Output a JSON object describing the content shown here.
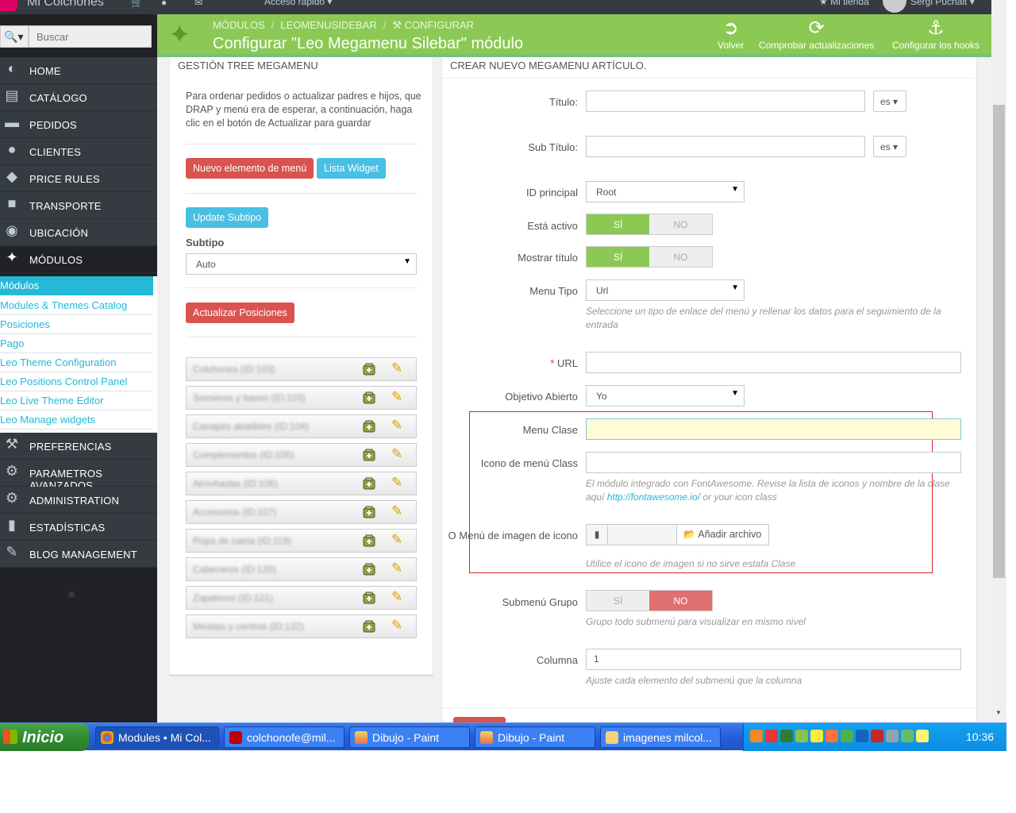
{
  "topbar": {
    "shop_name": "Mi Colchones",
    "quick_access": "Acceso rápido ▾",
    "my_shop": "★ Mi tienda",
    "user": "Sergi Puchalt ▾"
  },
  "sidebar": {
    "search_placeholder": "Buscar",
    "menu": [
      "HOME",
      "CATÁLOGO",
      "PEDIDOS",
      "CLIENTES",
      "PRICE RULES",
      "TRANSPORTE",
      "UBICACIÓN",
      "MÓDULOS"
    ],
    "submenu": [
      "Módulos",
      "Modules & Themes Catalog",
      "Posiciones",
      "Pago",
      "Leo Theme Configuration",
      "Leo Positions Control Panel",
      "Leo Live Theme Editor",
      "Leo Manage widgets"
    ],
    "menu_after": [
      "PREFERENCIAS",
      "PARAMETROS AVANZADOS",
      "ADMINISTRATION",
      "ESTADÍSTICAS",
      "BLOG MANAGEMENT"
    ],
    "collapse_icon": "≡"
  },
  "header": {
    "breadcrumb": [
      "MÓDULOS",
      "LEOMENUSIDEBAR",
      "CONFIGURAR"
    ],
    "title": "Configurar \"Leo Megamenu Silebar\" módulo",
    "buttons": [
      "Volver",
      "Comprobar actualizaciones",
      "Configurar los hooks"
    ]
  },
  "left_panel": {
    "heading": "GESTIÓN TREE MEGAMENU",
    "help": "Para ordenar pedidos o actualizar padres e hijos, que DRAP y menú era de esperar, a continuación, haga clic en el botón de Actualizar para guardar",
    "btn_new": "Nuevo elemento de menú",
    "btn_widget": "Lista Widget",
    "btn_update_subtipo": "Update Subtipo",
    "subtipo_label": "Subtipo",
    "subtipo_value": "Auto",
    "btn_update_positions": "Actualizar Posiciones",
    "tree_items": [
      "Colchones (ID:103)",
      "Somieres y bases (ID:103)",
      "Canapés abatibles (ID:104)",
      "Complementos (ID:105)",
      "Almohadas (ID:106)",
      "Accesorios (ID:107)",
      "Ropa de cama (ID:119)",
      "Cabeceros (ID:120)",
      "Zapateros (ID:121)",
      "Mesitas y centros (ID:122)"
    ]
  },
  "form": {
    "heading": "CREAR NUEVO MEGAMENU ARTÍCULO.",
    "titulo_label": "Título:",
    "lang": "es",
    "subtitulo_label": "Sub Título:",
    "id_principal_label": "ID principal",
    "id_principal_value": "Root",
    "activo_label": "Está activo",
    "yes": "SÍ",
    "no": "NO",
    "mostrar_titulo_label": "Mostrar título",
    "menu_tipo_label": "Menu Tipo",
    "menu_tipo_value": "Url",
    "menu_tipo_help": "Seleccione un tipo de enlace del menú y rellenar los datos para el seguimiento de la entrada",
    "url_label": "URL",
    "objetivo_label": "Objetivo Abierto",
    "objetivo_value": "Yo",
    "menu_clase_label": "Menu Clase",
    "icono_clase_label": "Icono de menú Class",
    "icono_help_pre": "El módulo integrado con FontAwesome. Revise la lista de iconos y nombre de la clase aquí",
    "icono_help_link": "http://fontawesome.io/",
    "icono_help_post": "or your icon class",
    "imagen_icono_label": "O Menú de imagen de icono",
    "add_file": "Añadir archivo",
    "imagen_help": "Utilice el icono de imagen si no sirve estafa Clase",
    "submenu_grupo_label": "Submenú Grupo",
    "submenu_grupo_help": "Grupo todo submenú para visualizar en mismo nivel",
    "columna_label": "Columna",
    "columna_value": "1",
    "columna_help": "Ajuste cada elemento del submenú que la columna"
  },
  "taskbar": {
    "start": "Inicio",
    "tasks": [
      "Modules • Mi Col...",
      "colchonofe@mil...",
      "Dibujo - Paint",
      "Dibujo - Paint",
      "imagenes milcol..."
    ],
    "clock": "10:36"
  }
}
